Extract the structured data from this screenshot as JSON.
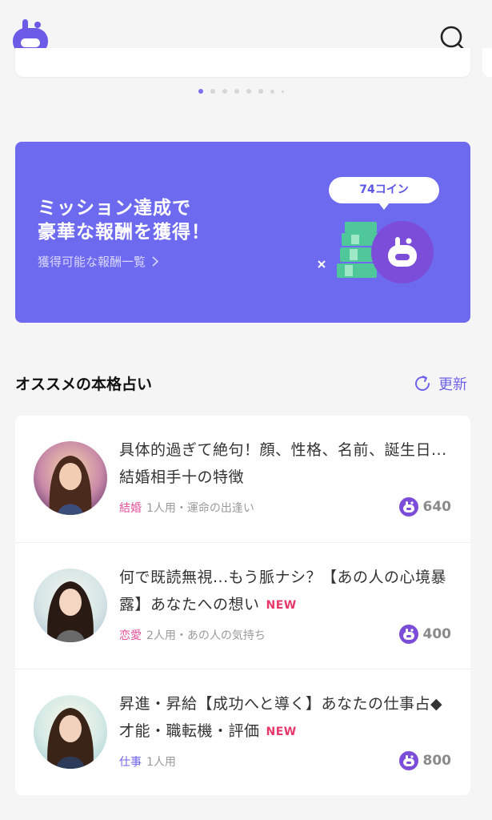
{
  "header": {
    "logo_icon": "app-logo-icon",
    "search_icon": "search-icon"
  },
  "carousel": {
    "dot_count": 8,
    "active_index": 0
  },
  "mission_banner": {
    "title_line1": "ミッション達成で",
    "title_line2": "豪華な報酬を獲得！",
    "link_label": "獲得可能な報酬一覧",
    "coin_bubble": "74コイン",
    "background_color": "#6e6af0"
  },
  "recommend": {
    "title": "オススメの本格占い",
    "refresh_label": "更新",
    "items": [
      {
        "title": "具体的過ぎて絶句！顔、性格、名前、誕生日...結婚相手十の特徴",
        "is_new": false,
        "new_label": "",
        "category": "結婚",
        "meta": "1人用・運命の出逢い",
        "price": "640"
      },
      {
        "title": "何で既読無視...もう脈ナシ？【あの人の心境暴露】あなたへの想い",
        "is_new": true,
        "new_label": "NEW",
        "category": "恋愛",
        "meta": "2人用・あの人の気持ち",
        "price": "400"
      },
      {
        "title": "昇進・昇給【成功へと導く】あなたの仕事占◆才能・職転機・評価",
        "is_new": true,
        "new_label": "NEW",
        "category": "仕事",
        "meta": "1人用",
        "price": "800"
      }
    ]
  },
  "colors": {
    "accent": "#6e63e8",
    "category_marriage": "#e3509a",
    "category_love": "#e3509a",
    "category_work": "#6e63e8",
    "new_badge": "#e8386a"
  }
}
